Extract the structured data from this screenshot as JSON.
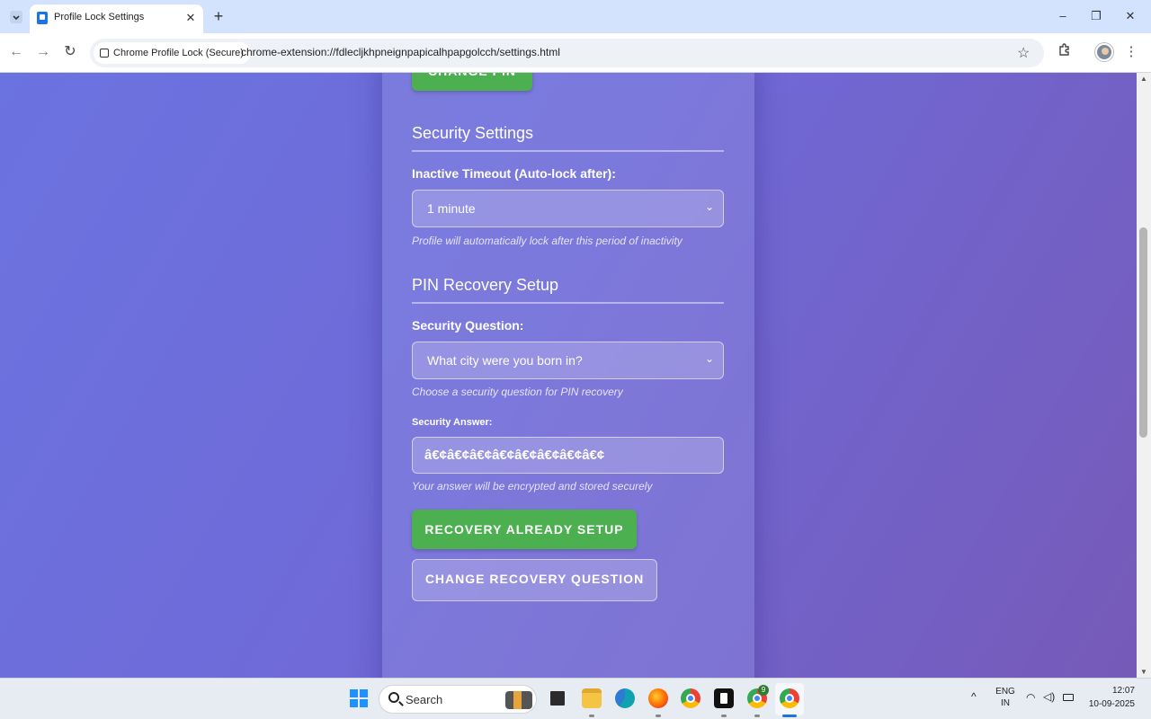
{
  "browser": {
    "tab_title": "Profile Lock Settings",
    "tab_close": "✕",
    "new_tab": "+",
    "window_controls": [
      "–",
      "❐",
      "✕"
    ],
    "site_chip": "Chrome Profile Lock (Secure)",
    "url": "chrome-extension://fdlecljkhpneignpapicalhpapgolcch/settings.html",
    "icons": [
      "tab-search-icon",
      "back-icon",
      "forward-icon",
      "reload-icon",
      "star-icon",
      "extensions-icon",
      "avatar",
      "kebab-menu-icon"
    ]
  },
  "page": {
    "change_pin_button": "CHANGE PIN",
    "security_section": {
      "title": "Security Settings",
      "timeout_label": "Inactive Timeout (Auto-lock after):",
      "timeout_value": "1 minute",
      "timeout_hint": "Profile will automatically lock after this period of inactivity"
    },
    "recovery_section": {
      "title": "PIN Recovery Setup",
      "question_label": "Security Question:",
      "question_value": "What city were you born in?",
      "question_hint": "Choose a security question for PIN recovery",
      "answer_label": "Security Answer:",
      "answer_value": "â€¢â€¢â€¢â€¢â€¢â€¢â€¢â€¢",
      "answer_hint": "Your answer will be encrypted and stored securely",
      "recovery_setup_button": "RECOVERY ALREADY SETUP",
      "change_question_button": "CHANGE RECOVERY QUESTION"
    }
  },
  "taskbar": {
    "search_label": "Search",
    "apps": [
      "widgets-icon",
      "file-manager-icon",
      "folder-icon",
      "edge-icon",
      "firefox-icon",
      "chrome-icon",
      "terminal-icon",
      "chrome-badge-icon",
      "chrome-active-icon"
    ],
    "badge_count": "9",
    "language": "ENG",
    "region": "IN",
    "time": "12:07",
    "date": "10-09-2025"
  },
  "colors": {
    "accent_green": "#4caf50",
    "background_start": "#6b73e0",
    "background_end": "#765ab8",
    "tab_strip": "#d3e3fd"
  }
}
